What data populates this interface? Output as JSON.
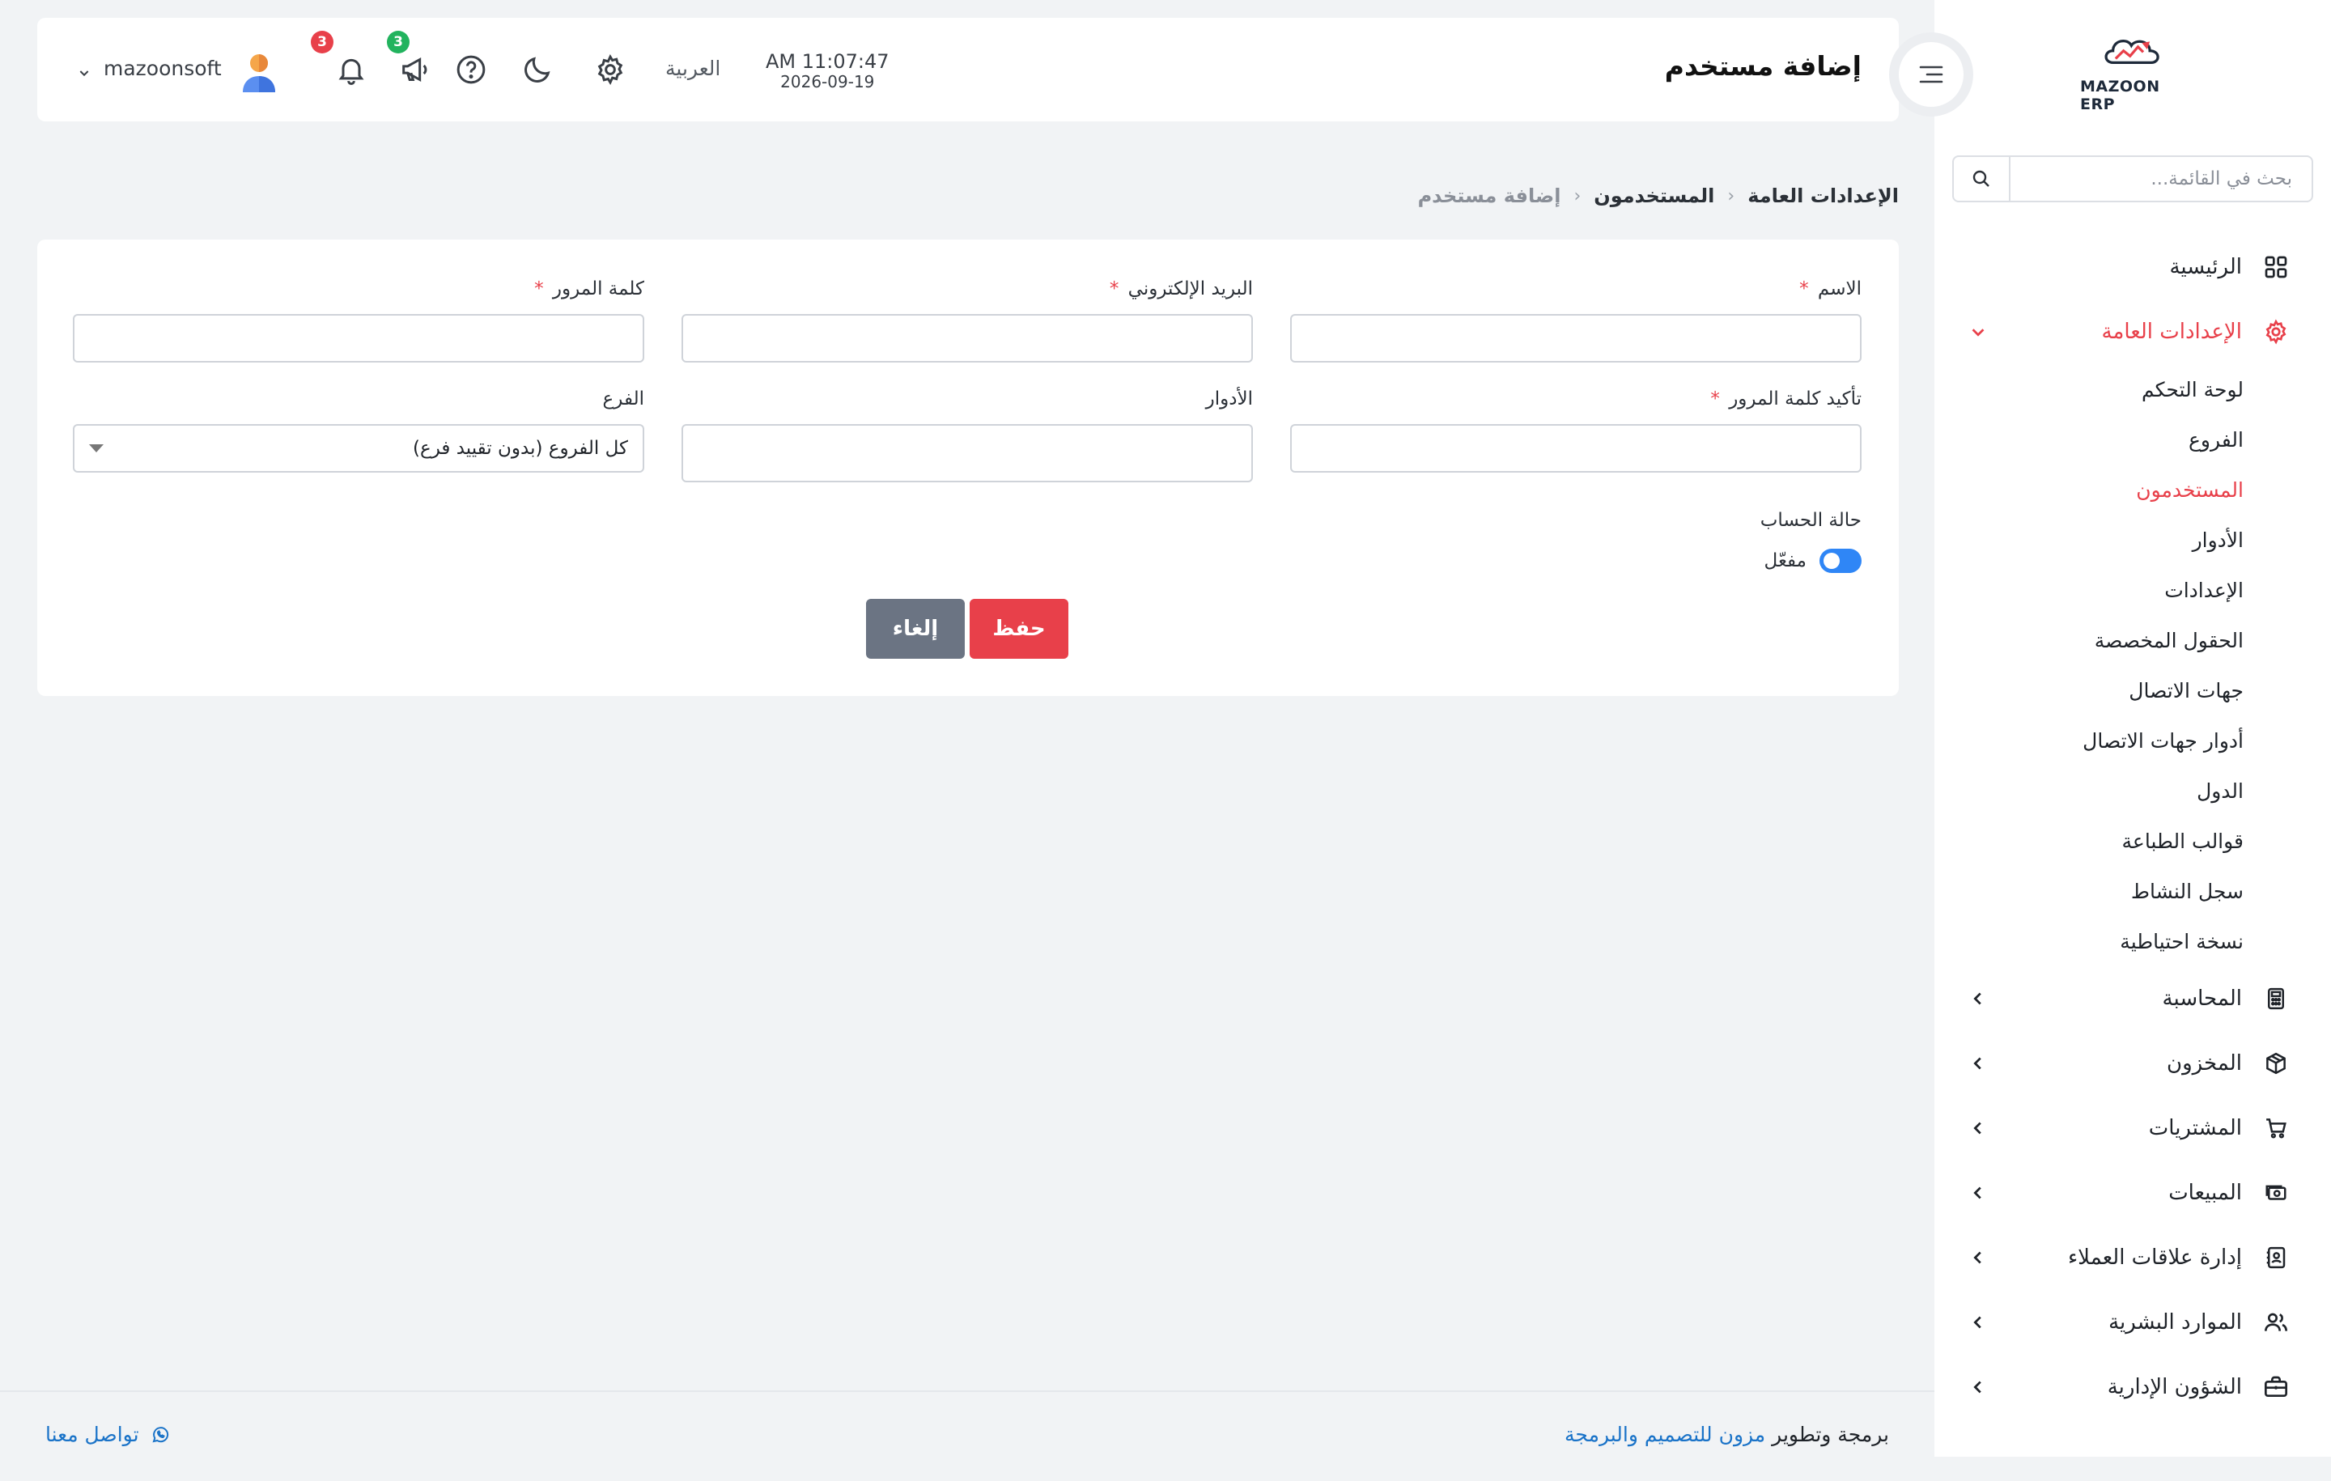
{
  "sidebar": {
    "logo_text": "MAZOON ERP",
    "search_placeholder": "بحث في القائمة...",
    "items": [
      {
        "label": "الرئيسية",
        "icon": "grid-icon"
      },
      {
        "label": "الإعدادات العامة",
        "icon": "gear-icon",
        "expanded": true,
        "children": [
          "لوحة التحكم",
          "الفروع",
          "المستخدمون",
          "الأدوار",
          "الإعدادات",
          "الحقول المخصصة",
          "جهات الاتصال",
          "أدوار جهات الاتصال",
          "الدول",
          "قوالب الطباعة",
          "سجل النشاط",
          "نسخة احتياطية"
        ],
        "active_child": "المستخدمون"
      },
      {
        "label": "المحاسبة",
        "icon": "calculator-icon"
      },
      {
        "label": "المخزون",
        "icon": "box-icon"
      },
      {
        "label": "المشتريات",
        "icon": "cart-icon"
      },
      {
        "label": "المبيعات",
        "icon": "cash-icon"
      },
      {
        "label": "إدارة علاقات العملاء",
        "icon": "contacts-book-icon"
      },
      {
        "label": "الموارد البشرية",
        "icon": "users-icon"
      },
      {
        "label": "الشؤون الإدارية",
        "icon": "briefcase-icon"
      }
    ]
  },
  "header": {
    "page_title": "إضافة مستخدم",
    "time": "AM 11:07:47",
    "date": "2026-09-19",
    "language": "العربية",
    "notifications_count": "3",
    "announcements_count": "3",
    "username": "mazoonsoft",
    "colors": {
      "notify_badge": "#e8404a",
      "announce_badge": "#22b35e"
    }
  },
  "breadcrumb": {
    "root": "الإعدادات العامة",
    "parent": "المستخدمون",
    "current": "إضافة مستخدم"
  },
  "form": {
    "name_label": "الاسم",
    "email_label": "البريد الإلكتروني",
    "password_label": "كلمة المرور",
    "confirm_password_label": "تأكيد كلمة المرور",
    "roles_label": "الأدوار",
    "branch_label": "الفرع",
    "branch_value": "كل الفروع (بدون تقييد فرع)",
    "required_mark": "*",
    "name_value": "",
    "email_value": "",
    "password_value": "",
    "confirm_password_value": "",
    "account_status_label": "حالة الحساب",
    "account_status_value": "مفعّل",
    "save_label": "حفظ",
    "cancel_label": "إلغاء",
    "colors": {
      "save": "#e8404a",
      "cancel": "#6b7483",
      "toggle_on": "#2f86f6"
    }
  },
  "footer": {
    "credit_prefix": "برمجة وتطوير",
    "credit_link": "مزون للتصميم والبرمجة",
    "contact_label": "تواصل معنا"
  }
}
